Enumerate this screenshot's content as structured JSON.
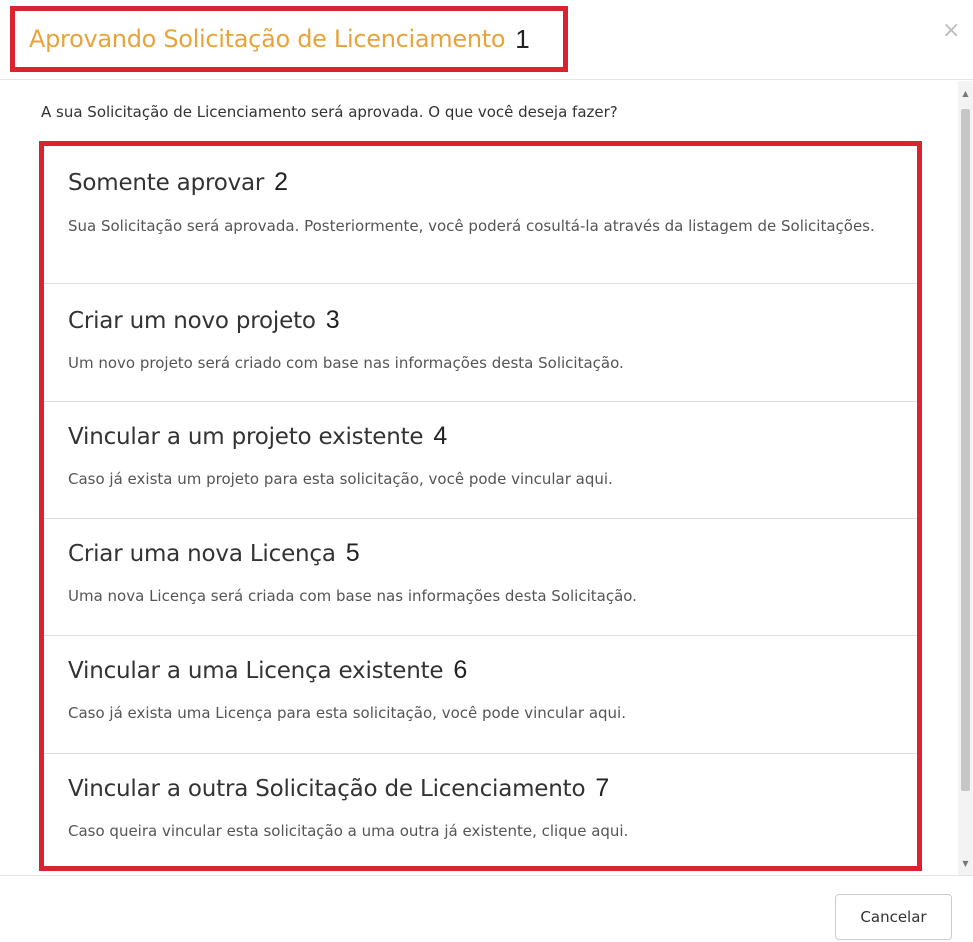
{
  "modal": {
    "title": "Aprovando Solicitação de Licenciamento",
    "title_number": "1",
    "close_icon": "close-icon",
    "prompt": "A sua Solicitação de Licenciamento será aprovada. O que você deseja fazer?",
    "options": [
      {
        "title": "Somente aprovar",
        "number": "2",
        "description": "Sua Solicitação será aprovada. Posteriormente, você poderá cosultá-la através da listagem de Solicitações."
      },
      {
        "title": "Criar um novo projeto",
        "number": "3",
        "description": "Um novo projeto será criado com base nas informações desta Solicitação."
      },
      {
        "title": "Vincular a um projeto existente",
        "number": "4",
        "description": "Caso já exista um projeto para esta solicitação, você pode vincular aqui."
      },
      {
        "title": "Criar uma nova Licença",
        "number": "5",
        "description": "Uma nova Licença será criada com base nas informações desta Solicitação."
      },
      {
        "title": "Vincular a uma Licença existente",
        "number": "6",
        "description": "Caso já exista uma Licença para esta solicitação, você pode vincular aqui."
      },
      {
        "title": "Vincular a outra Solicitação de Licenciamento",
        "number": "7",
        "description": "Caso queira vincular esta solicitação a uma outra já existente, clique aqui."
      }
    ],
    "cancel_label": "Cancelar"
  },
  "colors": {
    "title": "#e8a33c",
    "highlight_border": "#d9232e"
  }
}
